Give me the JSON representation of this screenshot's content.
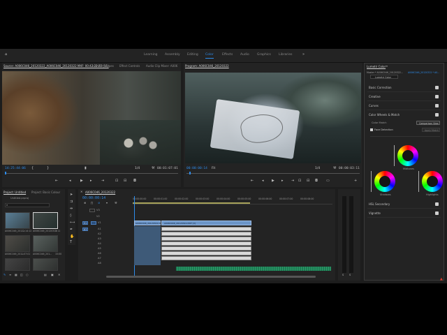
{
  "workspaces": [
    "Learning",
    "Assembly",
    "Editing",
    "Color",
    "Effects",
    "Audio",
    "Graphics",
    "Libraries"
  ],
  "active_workspace": "Color",
  "source_panel": {
    "tabs": [
      "Source: A006C046_20120322_A006C046_20120322 MXF: 00:42:22:22 (11)",
      "Lumetri Scopes",
      "Effect Controls",
      "Audio Clip Mixer: A006"
    ],
    "timecode_in": "14:25:44:06",
    "fit": "1/4",
    "duration": "00:01:07:01"
  },
  "program_panel": {
    "tab": "Program: A006C046_20120322",
    "timecode": "00:00:00:14",
    "fit": "Fit",
    "scale": "1/4",
    "duration": "00:00:03:11"
  },
  "project_panel": {
    "tabs": [
      "Project: Untitled",
      "Project: Basic Colour"
    ],
    "file": "Untitled.prproj",
    "items": [
      {
        "name": "A006C046_2012...",
        "duration": "2:14:12"
      },
      {
        "name": "A006C046_20120322",
        "duration": "3:11"
      },
      {
        "name": "A006C046_201...",
        "duration": "1:07:01"
      },
      {
        "name": "A006C046_201...",
        "duration": "15:00"
      },
      {
        "name": "",
        "duration": ""
      },
      {
        "name": "",
        "duration": ""
      }
    ]
  },
  "timeline": {
    "tab": "A006C046_20120322",
    "timecode": "00:00:00:14",
    "ruler": [
      "00:00:00:00",
      "00:00:01:00",
      "00:00:02:00",
      "00:00:03:00",
      "00:00:04:00",
      "00:00:05:00",
      "00:00:06:00",
      "00:00:07:00",
      "00:00:08:00"
    ],
    "tracks": [
      "V3",
      "V2",
      "V1",
      "A1",
      "A2",
      "A3",
      "A4",
      "A5",
      "A6",
      "A7",
      "A8"
    ],
    "clip_v1_label": "A006C046_20120322.MXF [V]",
    "clip_v1b_label": "A006C046_20120322.MXF [V]"
  },
  "lumetri": {
    "title": "Lumetri Color",
    "master": "Master * A006C046_20120322...",
    "clip": "A006C046_20120322 * A0...",
    "effect": "Lumetri Color",
    "sections": [
      "Basic Correction",
      "Creative",
      "Curves"
    ],
    "wheels_section": "Color Wheels & Match",
    "color_match": "Color Match",
    "comparison_btn": "Comparison View",
    "face_detection": "Face Detection",
    "apply_match": "Apply Match",
    "wheel_labels": [
      "Midtones",
      "Shadows",
      "Highlights"
    ],
    "bottom_sections": [
      "HSL Secondary",
      "Vignette"
    ]
  },
  "colors": {
    "accent": "#2d8ceb",
    "clip_video": "#6c95c7",
    "clip_audio_green": "#1d7a52"
  }
}
